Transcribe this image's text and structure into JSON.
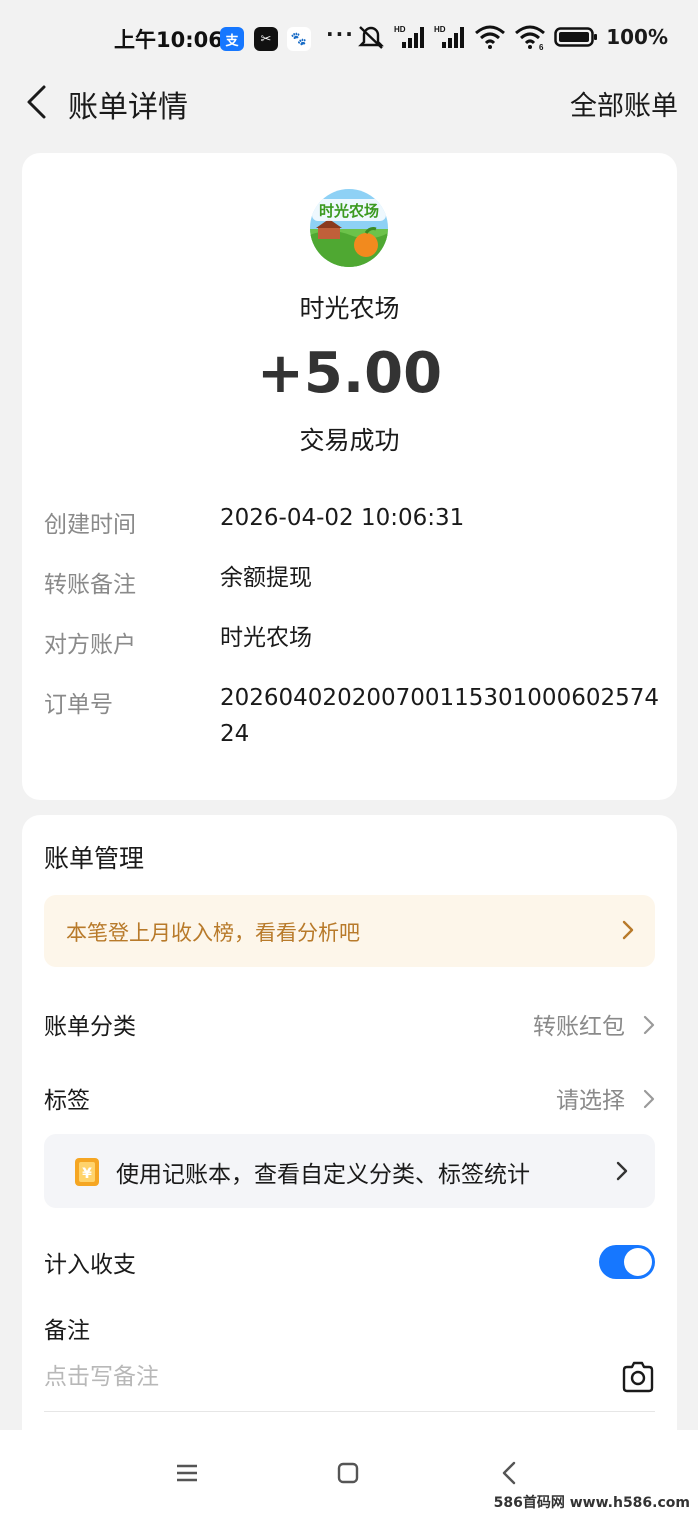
{
  "status_bar": {
    "time": "上午10:06",
    "battery": "100%",
    "apps": [
      "alipay-icon",
      "capcut-icon",
      "baidu-icon"
    ],
    "more": "···"
  },
  "header": {
    "title": "账单详情",
    "all_bills": "全部账单"
  },
  "merchant": {
    "logo_text": "时光农场",
    "name": "时光农场",
    "amount": "+5.00",
    "status": "交易成功"
  },
  "details": [
    {
      "label": "创建时间",
      "value": "2026-04-02 10:06:31"
    },
    {
      "label": "转账备注",
      "value": "余额提现"
    },
    {
      "label": "对方账户",
      "value": "时光农场"
    },
    {
      "label": "订单号",
      "value": "20260402020070011530100060257424"
    }
  ],
  "manage": {
    "title": "账单管理",
    "promo": "本笔登上月收入榜，看看分析吧",
    "category_label": "账单分类",
    "category_value": "转账红包",
    "tag_label": "标签",
    "tag_value": "请选择",
    "ledger_text": "使用记账本，查看自定义分类、标签统计",
    "ledger_icon_glyph": "¥",
    "include_label": "计入收支",
    "include_enabled": true,
    "note_label": "备注",
    "note_placeholder": "点击写备注"
  },
  "watermark": "586首码网 www.h586.com",
  "colors": {
    "accent": "#1677ff",
    "promo_text": "#b87a2a",
    "promo_bg": "#fdf6ea"
  }
}
